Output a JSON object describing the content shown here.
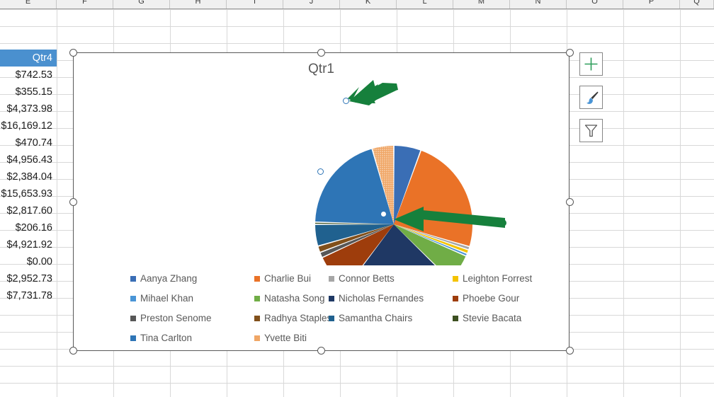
{
  "spreadsheet": {
    "column_headers": [
      "E",
      "F",
      "G",
      "H",
      "I",
      "J",
      "K",
      "L",
      "M",
      "N",
      "O",
      "P",
      "Q"
    ],
    "column_e": {
      "header": "Qtr4",
      "values": [
        "$742.53",
        "$355.15",
        "$4,373.98",
        "$16,169.12",
        "$470.74",
        "$4,956.43",
        "$2,384.04",
        "$15,653.93",
        "$2,817.60",
        "$206.16",
        "$4,921.92",
        "$0.00",
        "$2,952.73",
        "$7,731.78"
      ]
    }
  },
  "chart": {
    "title": "Qtr1",
    "selected_series_point": "Yvette Biti",
    "side_buttons": [
      {
        "name": "chart-elements-button",
        "icon": "plus-icon",
        "color": "#2e9e5b"
      },
      {
        "name": "chart-styles-button",
        "icon": "paintbrush-icon",
        "color": "#2e75b6"
      },
      {
        "name": "chart-filters-button",
        "icon": "funnel-icon",
        "color": "#585858"
      }
    ],
    "legend": [
      {
        "label": "Aanya Zhang",
        "color": "#3a6eb5"
      },
      {
        "label": "Charlie Bui",
        "color": "#ea7227"
      },
      {
        "label": "Connor Betts",
        "color": "#a6a6a6"
      },
      {
        "label": "Leighton Forrest",
        "color": "#f4c300"
      },
      {
        "label": "Mihael Khan",
        "color": "#4a95d6"
      },
      {
        "label": "Natasha Song",
        "color": "#70ad46"
      },
      {
        "label": "Nicholas Fernandes",
        "color": "#1f3864"
      },
      {
        "label": "Phoebe Gour",
        "color": "#9e3d0c"
      },
      {
        "label": "Preston Senome",
        "color": "#575757"
      },
      {
        "label": "Radhya Staples",
        "color": "#81501b"
      },
      {
        "label": "Samantha Chairs",
        "color": "#20618f"
      },
      {
        "label": "Stevie Bacata",
        "color": "#3d5021"
      },
      {
        "label": "Tina Carlton",
        "color": "#2e75b6"
      },
      {
        "label": "Yvette Biti",
        "color": "#f0a666"
      }
    ]
  },
  "chart_data": {
    "type": "pie",
    "title": "Qtr1",
    "legend_position": "bottom",
    "grid": false,
    "categories": [
      "Aanya Zhang",
      "Charlie Bui",
      "Connor Betts",
      "Leighton Forrest",
      "Mihael Khan",
      "Natasha Song",
      "Nicholas Fernandes",
      "Phoebe Gour",
      "Preston Senome",
      "Radhya Staples",
      "Samantha Chairs",
      "Stevie Bacata",
      "Tina Carlton",
      "Yvette Biti"
    ],
    "values": [
      5.0,
      21.5,
      0.6,
      0.7,
      0.5,
      5.2,
      20.5,
      0.4,
      7.0,
      1.0,
      1.2,
      4.0,
      0.4,
      18.0,
      4.0
    ],
    "series": [
      {
        "name": "Qtr1",
        "values": [
          5.0,
          21.5,
          0.6,
          0.7,
          0.5,
          5.2,
          20.5,
          7.0,
          1.0,
          1.2,
          4.0,
          0.4,
          18.0,
          4.0
        ],
        "colors": [
          "#3a6eb5",
          "#ea7227",
          "#a6a6a6",
          "#f4c300",
          "#4a95d6",
          "#70ad46",
          "#1f3864",
          "#9e3d0c",
          "#575757",
          "#81501b",
          "#20618f",
          "#3d5021",
          "#2e75b6",
          "#f0a666"
        ]
      }
    ],
    "unit": "percent"
  },
  "annotations": {
    "arrow_color": "#16803c",
    "arrows": [
      {
        "name": "arrow-to-first-datapoint",
        "direction": "down-left"
      },
      {
        "name": "arrow-to-last-datapoint",
        "direction": "left"
      }
    ]
  }
}
